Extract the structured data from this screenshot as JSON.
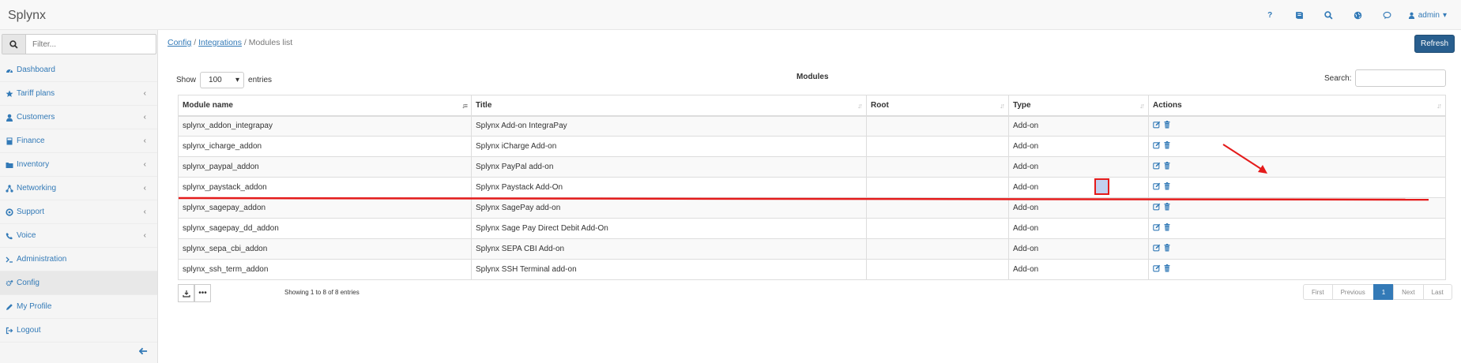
{
  "app": {
    "title": "Splynx"
  },
  "topbar": {
    "icons": [
      "help-icon",
      "book-icon",
      "search-icon",
      "globe-icon",
      "chat-icon"
    ],
    "help_label": "?",
    "user": "admin"
  },
  "sidebar": {
    "filter_placeholder": "Filter...",
    "items": [
      {
        "label": "Dashboard",
        "icon": "dashboard-icon",
        "has_children": false
      },
      {
        "label": "Tariff plans",
        "icon": "star-icon",
        "has_children": true
      },
      {
        "label": "Customers",
        "icon": "user-icon",
        "has_children": true
      },
      {
        "label": "Finance",
        "icon": "calculator-icon",
        "has_children": true
      },
      {
        "label": "Inventory",
        "icon": "folder-icon",
        "has_children": true
      },
      {
        "label": "Networking",
        "icon": "network-icon",
        "has_children": true
      },
      {
        "label": "Support",
        "icon": "lifebuoy-icon",
        "has_children": true
      },
      {
        "label": "Voice",
        "icon": "phone-icon",
        "has_children": true
      },
      {
        "label": "Administration",
        "icon": "terminal-icon",
        "has_children": false
      },
      {
        "label": "Config",
        "icon": "cogs-icon",
        "has_children": false,
        "active": true
      },
      {
        "label": "My Profile",
        "icon": "pencil-icon",
        "has_children": false
      },
      {
        "label": "Logout",
        "icon": "logout-icon",
        "has_children": false
      }
    ]
  },
  "breadcrumb": {
    "config": "Config",
    "sep1": " / ",
    "integrations": "Integrations",
    "sep2": " / ",
    "current": "Modules list"
  },
  "refresh_label": "Refresh",
  "table_controls": {
    "show": "Show",
    "entries_value": "100",
    "entries": "entries",
    "caption": "Modules",
    "search": "Search:"
  },
  "table": {
    "columns": [
      "Module name",
      "Title",
      "Root",
      "Type",
      "Actions"
    ],
    "rows": [
      {
        "name": "splynx_addon_integrapay",
        "title": "Splynx Add-on IntegraPay",
        "root": "",
        "type": "Add-on"
      },
      {
        "name": "splynx_icharge_addon",
        "title": "Splynx iCharge Add-on",
        "root": "",
        "type": "Add-on"
      },
      {
        "name": "splynx_paypal_addon",
        "title": "Splynx PayPal add-on",
        "root": "",
        "type": "Add-on"
      },
      {
        "name": "splynx_paystack_addon",
        "title": "Splynx Paystack Add-On",
        "root": "",
        "type": "Add-on"
      },
      {
        "name": "splynx_sagepay_addon",
        "title": "Splynx SagePay add-on",
        "root": "",
        "type": "Add-on"
      },
      {
        "name": "splynx_sagepay_dd_addon",
        "title": "Splynx Sage Pay Direct Debit Add-On",
        "root": "",
        "type": "Add-on"
      },
      {
        "name": "splynx_sepa_cbi_addon",
        "title": "Splynx SEPA CBI Add-on",
        "root": "",
        "type": "Add-on"
      },
      {
        "name": "splynx_ssh_term_addon",
        "title": "Splynx SSH Terminal add-on",
        "root": "",
        "type": "Add-on"
      }
    ]
  },
  "footer": {
    "info": "Showing 1 to 8 of 8 entries",
    "pager": {
      "first": "First",
      "previous": "Previous",
      "current": "1",
      "next": "Next",
      "last": "Last"
    }
  },
  "colors": {
    "accent": "#337ab7",
    "annotation": "#e41b1b"
  }
}
